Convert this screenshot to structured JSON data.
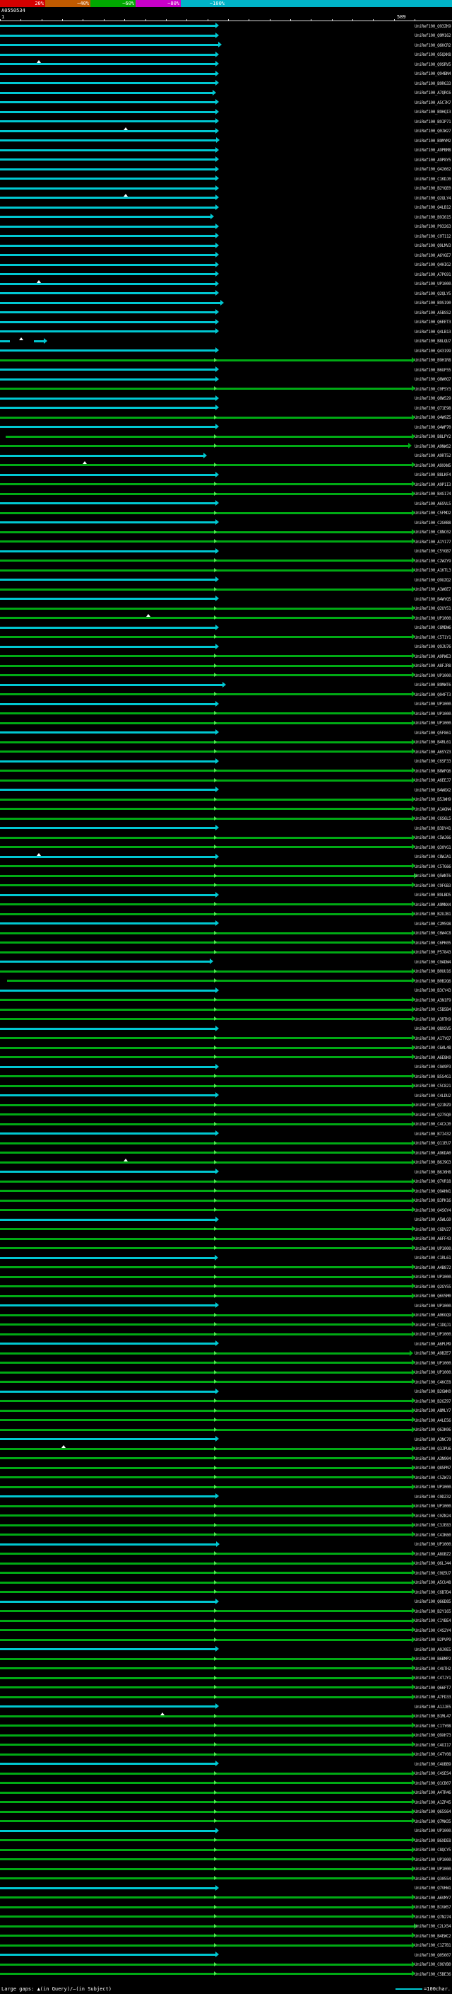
{
  "chart_data": {
    "type": "alignment_overview",
    "description": "BLAST graphical hit overview: query ruler on top, one colored alignment bar per database hit, colored by percent identity per the key",
    "query_id": "A0550534",
    "query_length": 589,
    "ruler": {
      "start_label": "1",
      "end_label": "589"
    },
    "key": {
      "stops": [
        {
          "label": "20%",
          "boundary": 64,
          "color": "#d40000"
        },
        {
          "label": "~40%",
          "boundary": 128,
          "color": "#c05a00"
        },
        {
          "label": "~60%",
          "boundary": 192,
          "color": "#00a800"
        },
        {
          "label": "~80%",
          "boundary": 256,
          "color": "#c800c8"
        },
        {
          "label": "~100%",
          "boundary": 320,
          "color": "#00b4c8"
        }
      ],
      "extend_color": "#00b4c8"
    },
    "colors": {
      "cyan": "#00c8d2",
      "green": "#00aa14",
      "green_bright": "#50e650",
      "gap": "#ffffff",
      "ruler": "#d8d8d8",
      "background": "#000000",
      "label_text": "#d8d8d8"
    },
    "label_prefix": "UniRef100_",
    "hits": [
      {
        "id": "Q93ZK9",
        "t": "c"
      },
      {
        "id": "Q9M162",
        "t": "c"
      },
      {
        "id": "Q6KCR2",
        "t": "c",
        "e": 309
      },
      {
        "id": "O5QXK8",
        "t": "c"
      },
      {
        "id": "Q9SRV5",
        "t": "c",
        "gp": [
          55
        ]
      },
      {
        "id": "Q94BN4",
        "t": "c"
      },
      {
        "id": "B9RG33",
        "t": "c"
      },
      {
        "id": "A7QRC6",
        "t": "c",
        "e": 301
      },
      {
        "id": "A5C7K7",
        "t": "c"
      },
      {
        "id": "B9HQI3",
        "t": "c"
      },
      {
        "id": "B9IP71",
        "t": "c"
      },
      {
        "id": "Q0JW27",
        "t": "c",
        "gp": [
          178
        ]
      },
      {
        "id": "B9MYM2",
        "t": "c",
        "e": 306
      },
      {
        "id": "A9PBM8",
        "t": "c"
      },
      {
        "id": "A9P8Y5",
        "t": "c"
      },
      {
        "id": "Q42662",
        "t": "c"
      },
      {
        "id": "C1KDJ0",
        "t": "c"
      },
      {
        "id": "B2YQE0",
        "t": "c"
      },
      {
        "id": "Q2QLY4",
        "t": "c",
        "gp": [
          178
        ]
      },
      {
        "id": "Q4LB12",
        "t": "c"
      },
      {
        "id": "B9I615",
        "t": "c",
        "e": 298
      },
      {
        "id": "P93263",
        "t": "c"
      },
      {
        "id": "C0T112",
        "t": "c"
      },
      {
        "id": "Q9LMV3",
        "t": "c"
      },
      {
        "id": "A6YGE7",
        "t": "c"
      },
      {
        "id": "Q4HIG2",
        "t": "c"
      },
      {
        "id": "A7PG91",
        "t": "c"
      },
      {
        "id": "UP1000...",
        "t": "c",
        "gp": [
          55
        ]
      },
      {
        "id": "Q2QLY5",
        "t": "c"
      },
      {
        "id": "B9S190",
        "t": "c",
        "e": 312
      },
      {
        "id": "A5BSS2",
        "t": "c"
      },
      {
        "id": "Q6EET3",
        "t": "c"
      },
      {
        "id": "Q4LB13",
        "t": "c"
      },
      {
        "id": "B8LQU7",
        "t": "f",
        "segs": [
          [
            0,
            14
          ],
          [
            48,
            62
          ]
        ],
        "gp": [
          30
        ]
      },
      {
        "id": "Q43199",
        "t": "c"
      },
      {
        "id": "B9H1R8",
        "t": "g"
      },
      {
        "id": "B6UF55",
        "t": "c"
      },
      {
        "id": "Q8W0Q7",
        "t": "c"
      },
      {
        "id": "C0PSY3",
        "t": "g"
      },
      {
        "id": "Q8W529",
        "t": "c"
      },
      {
        "id": "Q71E98",
        "t": "c"
      },
      {
        "id": "Q4W9Z5",
        "t": "g"
      },
      {
        "id": "Q4WP70",
        "t": "c"
      },
      {
        "id": "B8LPY2",
        "t": "g",
        "s": 8
      },
      {
        "id": "A9NWS2",
        "t": "g",
        "e": 578
      },
      {
        "id": "A9RT52",
        "t": "c",
        "e": 288
      },
      {
        "id": "A9XXW5",
        "t": "g",
        "gp": [
          120
        ]
      },
      {
        "id": "B8LKF4",
        "t": "c"
      },
      {
        "id": "A9P1I3",
        "t": "g"
      },
      {
        "id": "B4G174",
        "t": "g"
      },
      {
        "id": "A6SVL5",
        "t": "c"
      },
      {
        "id": "C5FMD2",
        "t": "g"
      },
      {
        "id": "C2G0B8",
        "t": "c"
      },
      {
        "id": "C8NC02",
        "t": "g"
      },
      {
        "id": "A1Y177",
        "t": "g"
      },
      {
        "id": "C5YGB7",
        "t": "c"
      },
      {
        "id": "C2WZY9",
        "t": "g"
      },
      {
        "id": "A1KTL3",
        "t": "g"
      },
      {
        "id": "Q9UZQ2",
        "t": "c"
      },
      {
        "id": "A1W6E7",
        "t": "g"
      },
      {
        "id": "B4WYQ5",
        "t": "c"
      },
      {
        "id": "Q2UY51",
        "t": "g"
      },
      {
        "id": "UP1000...",
        "t": "g",
        "gp": [
          210
        ]
      },
      {
        "id": "C6MDW6",
        "t": "c"
      },
      {
        "id": "C5T1Y1",
        "t": "g"
      },
      {
        "id": "Q9JU76",
        "t": "c"
      },
      {
        "id": "A9PWE3",
        "t": "g"
      },
      {
        "id": "A8FJR8",
        "t": "g"
      },
      {
        "id": "UP1000...",
        "t": "g"
      },
      {
        "id": "B9MWT6",
        "t": "c",
        "e": 315
      },
      {
        "id": "Q04FT3",
        "t": "g"
      },
      {
        "id": "UP1000...",
        "t": "c"
      },
      {
        "id": "UP1000...",
        "t": "g"
      },
      {
        "id": "UP1000...",
        "t": "g"
      },
      {
        "id": "Q5F861",
        "t": "c"
      },
      {
        "id": "B4RL61",
        "t": "g"
      },
      {
        "id": "A6SYZ3",
        "t": "g"
      },
      {
        "id": "C6SF33",
        "t": "c"
      },
      {
        "id": "B8WFQ6",
        "t": "g"
      },
      {
        "id": "A6EEJ7",
        "t": "g"
      },
      {
        "id": "B4W8X2",
        "t": "c"
      },
      {
        "id": "B5JWH9",
        "t": "g"
      },
      {
        "id": "A1AGN4",
        "t": "g"
      },
      {
        "id": "C6S6L5",
        "t": "g"
      },
      {
        "id": "B3DY41",
        "t": "c"
      },
      {
        "id": "C5WJ66",
        "t": "g"
      },
      {
        "id": "Q30YG1",
        "t": "g"
      },
      {
        "id": "C8WJA1",
        "t": "c",
        "gp": [
          55
        ]
      },
      {
        "id": "C5TG66",
        "t": "g"
      },
      {
        "id": "Q5WNT6",
        "t": "g",
        "e": 586
      },
      {
        "id": "C9FGB3",
        "t": "g"
      },
      {
        "id": "B9LBD5",
        "t": "c"
      },
      {
        "id": "A9MNX4",
        "t": "g"
      },
      {
        "id": "B2UJB1",
        "t": "g"
      },
      {
        "id": "C2M598",
        "t": "c"
      },
      {
        "id": "C6W4C8",
        "t": "g"
      },
      {
        "id": "C6PK05",
        "t": "g"
      },
      {
        "id": "P57843",
        "t": "g"
      },
      {
        "id": "C0ADW4",
        "t": "c",
        "e": 297
      },
      {
        "id": "B0UU16",
        "t": "g"
      },
      {
        "id": "B0B2Q6",
        "t": "g",
        "s": 10
      },
      {
        "id": "B3CY43",
        "t": "c"
      },
      {
        "id": "A3N1F9",
        "t": "g"
      },
      {
        "id": "C5B5B4",
        "t": "g"
      },
      {
        "id": "A3RTK9",
        "t": "g"
      },
      {
        "id": "Q8XSV5",
        "t": "c"
      },
      {
        "id": "A1TYQ7",
        "t": "g"
      },
      {
        "id": "C6AL48",
        "t": "g"
      },
      {
        "id": "A6E8K0",
        "t": "g"
      },
      {
        "id": "C0A9P3",
        "t": "c"
      },
      {
        "id": "B5S4G1",
        "t": "g"
      },
      {
        "id": "C5C821",
        "t": "g"
      },
      {
        "id": "C4LDU2",
        "t": "c"
      },
      {
        "id": "Q21NZ9",
        "t": "g"
      },
      {
        "id": "Q27SQ0",
        "t": "g"
      },
      {
        "id": "C4CXJ0",
        "t": "g"
      },
      {
        "id": "B7I432",
        "t": "c"
      },
      {
        "id": "Q11EU7",
        "t": "g"
      },
      {
        "id": "A9KDA0",
        "t": "g"
      },
      {
        "id": "B6J9G3",
        "t": "g",
        "gp": [
          178
        ]
      },
      {
        "id": "B6J6H8",
        "t": "c"
      },
      {
        "id": "Q7VR18",
        "t": "g"
      },
      {
        "id": "Q9AHW1",
        "t": "g"
      },
      {
        "id": "B3PK16",
        "t": "g"
      },
      {
        "id": "Q4SGY4",
        "t": "g"
      },
      {
        "id": "A5WLG0",
        "t": "c"
      },
      {
        "id": "C6DV27",
        "t": "g"
      },
      {
        "id": "A6FF43",
        "t": "g"
      },
      {
        "id": "UP1000...",
        "t": "g"
      },
      {
        "id": "C1RL61",
        "t": "c",
        "e": 304
      },
      {
        "id": "A4B872",
        "t": "g"
      },
      {
        "id": "UP1000...",
        "t": "g"
      },
      {
        "id": "Q2GY55",
        "t": "g"
      },
      {
        "id": "Q6V5M0",
        "t": "g"
      },
      {
        "id": "UP1000...",
        "t": "c"
      },
      {
        "id": "A0KGQ9",
        "t": "g"
      },
      {
        "id": "C1DQJ1",
        "t": "g"
      },
      {
        "id": "UP1000...",
        "t": "g"
      },
      {
        "id": "A6PLM9",
        "t": "c"
      },
      {
        "id": "A9BZE7",
        "t": "g",
        "e": 580
      },
      {
        "id": "UP1000...",
        "t": "g"
      },
      {
        "id": "UP1000...",
        "t": "g"
      },
      {
        "id": "C4KCE8",
        "t": "g"
      },
      {
        "id": "B2GWK0",
        "t": "c"
      },
      {
        "id": "B2GZ97",
        "t": "g"
      },
      {
        "id": "A8MLY7",
        "t": "g"
      },
      {
        "id": "A4LE56",
        "t": "g"
      },
      {
        "id": "Q63K06",
        "t": "g"
      },
      {
        "id": "A3NC70",
        "t": "c"
      },
      {
        "id": "Q3JPU6",
        "t": "g",
        "gp": [
          90
        ]
      },
      {
        "id": "A3N904",
        "t": "g"
      },
      {
        "id": "Q85PN7",
        "t": "g"
      },
      {
        "id": "C5ZW73",
        "t": "g"
      },
      {
        "id": "UP1000...",
        "t": "g"
      },
      {
        "id": "C0DZ32",
        "t": "c"
      },
      {
        "id": "UP1000...",
        "t": "g"
      },
      {
        "id": "C0ZN24",
        "t": "g"
      },
      {
        "id": "C3JE83",
        "t": "g"
      },
      {
        "id": "C4IK60",
        "t": "g"
      },
      {
        "id": "UP1000...",
        "t": "c",
        "e": 306
      },
      {
        "id": "A8GBZ2",
        "t": "g"
      },
      {
        "id": "Q6LJ44",
        "t": "g"
      },
      {
        "id": "C0Q5U7",
        "t": "g"
      },
      {
        "id": "A5CU48",
        "t": "g"
      },
      {
        "id": "C6B7D4",
        "t": "g"
      },
      {
        "id": "Q66D85",
        "t": "c"
      },
      {
        "id": "B2Y165",
        "t": "g"
      },
      {
        "id": "C1YBE4",
        "t": "g"
      },
      {
        "id": "C4S2Y4",
        "t": "g"
      },
      {
        "id": "B2PVP9",
        "t": "g"
      },
      {
        "id": "A0J0E5",
        "t": "c"
      },
      {
        "id": "B6BMP2",
        "t": "g"
      },
      {
        "id": "C4UTH2",
        "t": "g"
      },
      {
        "id": "C4TJY1",
        "t": "g"
      },
      {
        "id": "Q66FT7",
        "t": "g"
      },
      {
        "id": "A7FD33",
        "t": "g"
      },
      {
        "id": "A1JJE5",
        "t": "c"
      },
      {
        "id": "B1ML47",
        "t": "g",
        "gp": [
          230
        ]
      },
      {
        "id": "C1TY08",
        "t": "g"
      },
      {
        "id": "Q9XH73",
        "t": "g"
      },
      {
        "id": "C4GI17",
        "t": "g"
      },
      {
        "id": "C4TY08",
        "t": "g"
      },
      {
        "id": "C4UBB9",
        "t": "c"
      },
      {
        "id": "C4SES4",
        "t": "g"
      },
      {
        "id": "Q1CB07",
        "t": "g"
      },
      {
        "id": "A4TR46",
        "t": "g"
      },
      {
        "id": "A1ZP45",
        "t": "g"
      },
      {
        "id": "Q65S64",
        "t": "g"
      },
      {
        "id": "Q7MW35",
        "t": "g"
      },
      {
        "id": "UP1000...",
        "t": "c"
      },
      {
        "id": "B6XDE8",
        "t": "g"
      },
      {
        "id": "C8QCY5",
        "t": "g"
      },
      {
        "id": "UP1000...",
        "t": "g"
      },
      {
        "id": "UP1000...",
        "t": "g"
      },
      {
        "id": "Q30554",
        "t": "g"
      },
      {
        "id": "Q7VHW1",
        "t": "c"
      },
      {
        "id": "A6VMY7",
        "t": "g"
      },
      {
        "id": "B1VW57",
        "t": "g"
      },
      {
        "id": "Q7N274",
        "t": "g"
      },
      {
        "id": "C2LX54",
        "t": "g",
        "e": 586
      },
      {
        "id": "B4EWC2",
        "t": "g"
      },
      {
        "id": "C1Z7B1",
        "t": "g"
      },
      {
        "id": "Q05607",
        "t": "c"
      },
      {
        "id": "C0GYB0",
        "t": "g"
      },
      {
        "id": "C5BE36",
        "t": "g"
      }
    ]
  },
  "footer": {
    "left": "Large gaps: ▲(in Query)/―(in Subject)",
    "scale_label": "=100char."
  }
}
